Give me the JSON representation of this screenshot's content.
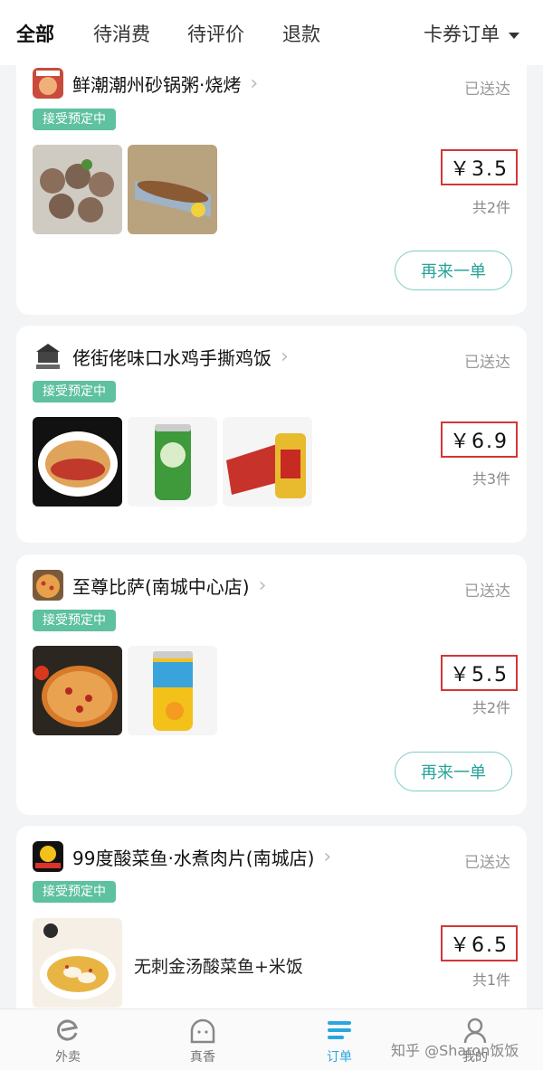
{
  "tabs": [
    {
      "label": "全部"
    },
    {
      "label": "待消费"
    },
    {
      "label": "待评价"
    },
    {
      "label": "退款"
    }
  ],
  "card_filter": "卡券订单",
  "orders": [
    {
      "store": "鲜潮潮州砂锅粥·烧烤",
      "status": "已送达",
      "badge": "接受预定中",
      "price": "￥3.5",
      "count": "共2件",
      "reorder": "再来一单"
    },
    {
      "store": "佬街佬味口水鸡手撕鸡饭",
      "status": "已送达",
      "badge": "接受预定中",
      "price": "￥6.9",
      "count": "共3件"
    },
    {
      "store": "至尊比萨(南城中心店)",
      "status": "已送达",
      "badge": "接受预定中",
      "price": "￥5.5",
      "count": "共2件",
      "reorder": "再来一单"
    },
    {
      "store": "99度酸菜鱼·水煮肉片(南城店)",
      "status": "已送达",
      "badge": "接受预定中",
      "price": "￥6.5",
      "count": "共1件",
      "item_text": "无刺金汤酸菜鱼+米饭"
    }
  ],
  "bottom_nav": [
    {
      "label": "外卖"
    },
    {
      "label": "真香"
    },
    {
      "label": "订单"
    },
    {
      "label": "我的"
    }
  ],
  "watermark": "知乎 @Sharon饭饭",
  "colors": {
    "accent": "#2aa7e0",
    "badge": "#5ec1a0",
    "highlight_box": "#d43636",
    "reorder": "#28a39a"
  }
}
